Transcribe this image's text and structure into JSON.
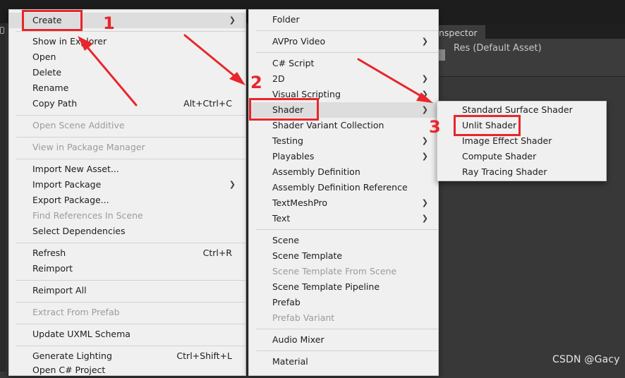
{
  "background": {
    "inspector_tab": "nspector",
    "asset_title": "Res (Default Asset)",
    "watermark": "CSDN @Gacy"
  },
  "menu_main": {
    "items": [
      {
        "label": "Create",
        "submenu": true,
        "highlighted": true
      },
      {
        "label": "Show in Explorer"
      },
      {
        "label": "Open"
      },
      {
        "label": "Delete"
      },
      {
        "label": "Rename"
      },
      {
        "label": "Copy Path",
        "shortcut": "Alt+Ctrl+C"
      },
      {
        "label": "Open Scene Additive",
        "disabled": true
      },
      {
        "label": "View in Package Manager",
        "disabled": true
      },
      {
        "label": "Import New Asset..."
      },
      {
        "label": "Import Package",
        "submenu": true
      },
      {
        "label": "Export Package..."
      },
      {
        "label": "Find References In Scene",
        "disabled": true
      },
      {
        "label": "Select Dependencies"
      },
      {
        "label": "Refresh",
        "shortcut": "Ctrl+R"
      },
      {
        "label": "Reimport"
      },
      {
        "label": "Reimport All"
      },
      {
        "label": "Extract From Prefab",
        "disabled": true
      },
      {
        "label": "Update UXML Schema"
      },
      {
        "label": "Generate Lighting",
        "shortcut": "Ctrl+Shift+L"
      },
      {
        "label": "Open C# Project"
      }
    ]
  },
  "menu_create": {
    "items": [
      {
        "label": "Folder"
      },
      {
        "label": "AVPro Video",
        "submenu": true
      },
      {
        "label": "C# Script"
      },
      {
        "label": "2D",
        "submenu": true
      },
      {
        "label": "Visual Scripting",
        "submenu": true
      },
      {
        "label": "Shader",
        "submenu": true,
        "highlighted": true
      },
      {
        "label": "Shader Variant Collection"
      },
      {
        "label": "Testing",
        "submenu": true
      },
      {
        "label": "Playables",
        "submenu": true
      },
      {
        "label": "Assembly Definition"
      },
      {
        "label": "Assembly Definition Reference"
      },
      {
        "label": "TextMeshPro",
        "submenu": true
      },
      {
        "label": "Text",
        "submenu": true
      },
      {
        "label": "Scene"
      },
      {
        "label": "Scene Template"
      },
      {
        "label": "Scene Template From Scene",
        "disabled": true
      },
      {
        "label": "Scene Template Pipeline"
      },
      {
        "label": "Prefab"
      },
      {
        "label": "Prefab Variant",
        "disabled": true
      },
      {
        "label": "Audio Mixer"
      },
      {
        "label": "Material"
      }
    ]
  },
  "menu_shader": {
    "items": [
      {
        "label": "Standard Surface Shader"
      },
      {
        "label": "Unlit Shader"
      },
      {
        "label": "Image Effect Shader"
      },
      {
        "label": "Compute Shader"
      },
      {
        "label": "Ray Tracing Shader"
      }
    ]
  },
  "annotations": {
    "step1": "1",
    "step2": "2",
    "step3": "3",
    "color": "#e8262b"
  },
  "glyphs": {
    "submenu_arrow": "❯"
  }
}
